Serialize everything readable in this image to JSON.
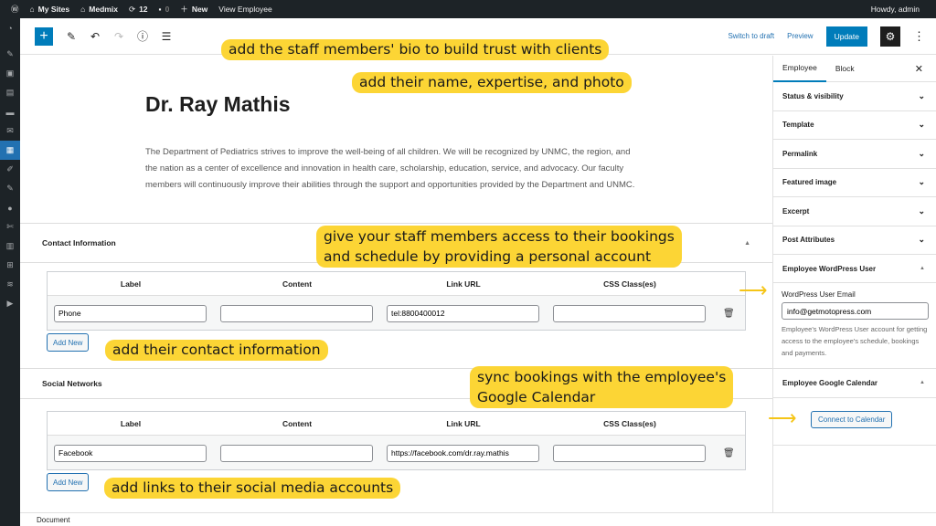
{
  "adminbar": {
    "my_sites": "My Sites",
    "site": "Medmix",
    "updates": "12",
    "comments": "0",
    "new": "New",
    "view": "View Employee",
    "howdy": "Howdy, admin"
  },
  "toolbar": {
    "switch_draft": "Switch to draft",
    "preview": "Preview",
    "update": "Update"
  },
  "post": {
    "title": "Dr. Ray Mathis",
    "bio": "The Department of Pediatrics strives to improve the well-being of all children. We will be recognized by UNMC, the region, and the nation as a center of excellence and innovation in health care, scholarship, education, service, and advocacy. Our faculty members will continuously improve their abilities through the support and opportunities provided by the Department and UNMC."
  },
  "contact": {
    "title": "Contact Information",
    "headers": [
      "Label",
      "Content",
      "Link URL",
      "CSS Class(es)"
    ],
    "row": {
      "label": "Phone",
      "content": "",
      "url": "tel:8800400012",
      "css": ""
    },
    "add": "Add New"
  },
  "social": {
    "title": "Social Networks",
    "headers": [
      "Label",
      "Content",
      "Link URL",
      "CSS Class(es)"
    ],
    "row": {
      "label": "Facebook",
      "content": "",
      "url": "https://facebook.com/dr.ray.mathis",
      "css": ""
    },
    "add": "Add New"
  },
  "sidebar": {
    "tabs": [
      "Employee",
      "Block"
    ],
    "panels": [
      "Status & visibility",
      "Template",
      "Permalink",
      "Featured image",
      "Excerpt",
      "Post Attributes"
    ],
    "wp_user": {
      "title": "Employee WordPress User",
      "label": "WordPress User Email",
      "email": "info@getmotopress.com",
      "help": "Employee's WordPress User account for getting access to the employee's schedule, bookings and payments."
    },
    "gcal": {
      "title": "Employee Google Calendar",
      "button": "Connect to Calendar"
    }
  },
  "footer": {
    "label": "Document"
  },
  "notes": {
    "n1": "add the staff members' bio to build trust with clients",
    "n2": "add their name, expertise, and photo",
    "n3a": "give your staff members access to their bookings",
    "n3b": "and schedule by providing a personal account",
    "n4": "add their contact information",
    "n5a": "sync bookings with the employee's",
    "n5b": "Google Calendar",
    "n6": "add links to their social media accounts"
  },
  "colors": {
    "accent": "#007cba",
    "highlight": "#fcd535",
    "adminbar": "#1d2327"
  }
}
